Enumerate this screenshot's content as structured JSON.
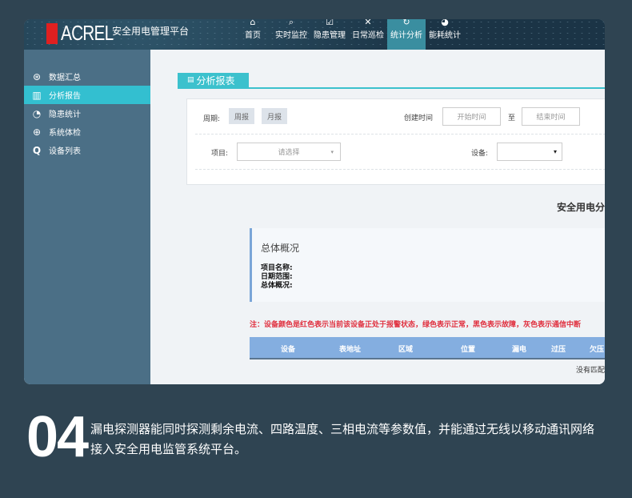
{
  "header": {
    "logo": "ACREL",
    "platform": "安全用电管理平台",
    "nav": [
      {
        "label": "首页",
        "icon": "home-icon",
        "glyph": "⌂"
      },
      {
        "label": "实时监控",
        "icon": "monitor-icon",
        "glyph": "⌕"
      },
      {
        "label": "隐患管理",
        "icon": "checklist-icon",
        "glyph": "☑"
      },
      {
        "label": "日常巡检",
        "icon": "tools-icon",
        "glyph": "✕"
      },
      {
        "label": "统计分析",
        "icon": "analysis-icon",
        "glyph": "↻",
        "active": true
      },
      {
        "label": "能耗统计",
        "icon": "pie-icon",
        "glyph": "◕"
      }
    ]
  },
  "sidebar": {
    "items": [
      {
        "label": "数据汇总",
        "icon": "dashboard-icon",
        "glyph": "⊛"
      },
      {
        "label": "分析报告",
        "icon": "bar-chart-icon",
        "glyph": "▥",
        "active": true
      },
      {
        "label": "隐患统计",
        "icon": "pie-icon",
        "glyph": "◔"
      },
      {
        "label": "系统体检",
        "icon": "plus-circle-icon",
        "glyph": "⊕"
      },
      {
        "label": "设备列表",
        "icon": "search-icon",
        "glyph": "🔍"
      }
    ]
  },
  "main": {
    "tab": "分析报表",
    "filter": {
      "period_label": "周期:",
      "weekly": "周报",
      "monthly": "月报",
      "created_label": "创建时间",
      "start_placeholder": "开始时间",
      "to": "至",
      "end_placeholder": "结束时间",
      "project_label": "项目:",
      "project_placeholder": "请选择",
      "device_label": "设备:"
    },
    "report_title": "安全用电分",
    "overview": {
      "title": "总体概况",
      "fields": [
        "项目名称:",
        "日期范围:",
        "总体概况:"
      ]
    },
    "note": "注：设备颜色是红色表示当前该设备正处于报警状态，绿色表示正常，黑色表示故障，灰色表示通信中断",
    "columns": [
      "设备",
      "表地址",
      "区域",
      "位置",
      "漏电",
      "过压",
      "欠压"
    ],
    "empty": "没有匹配"
  },
  "caption": {
    "number": "04",
    "text": "漏电探测器能同时探测剩余电流、四路温度、三相电流等参数值，并能通过无线以移动通讯网络接入安全用电监管系统平台。"
  },
  "colors": {
    "accent": "#3cc1cd",
    "sidebar": "#4b6f86",
    "note": "#e0303f",
    "table_header": "#84aee0"
  }
}
